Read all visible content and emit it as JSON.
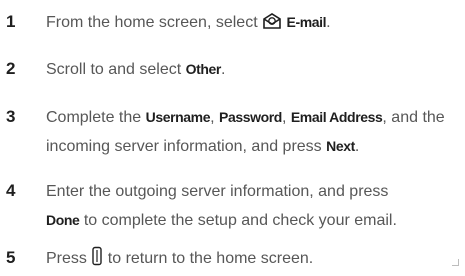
{
  "steps": [
    {
      "number": "1",
      "text_a": "From the home screen, select ",
      "icon": "email-envelope-icon",
      "key_a": "E-mail",
      "text_b": "."
    },
    {
      "number": "2",
      "text_a": "Scroll to and select ",
      "key_a": "Other",
      "text_b": "."
    },
    {
      "number": "3",
      "text_a": "Complete the ",
      "key_a": "Username",
      "text_b": ", ",
      "key_b": "Password",
      "text_c": ", ",
      "key_c": "Email Address",
      "text_d": ", and the",
      "line2_a": "incoming server information, and press ",
      "line2_key": "Next",
      "line2_b": "."
    },
    {
      "number": "4",
      "line1": "Enter the outgoing server information, and press",
      "line2_key": "Done",
      "line2_b": " to complete the setup and check your email."
    },
    {
      "number": "5",
      "text_a": "Press ",
      "icon": "end-key-icon",
      "text_b": " to return to the home screen."
    }
  ]
}
